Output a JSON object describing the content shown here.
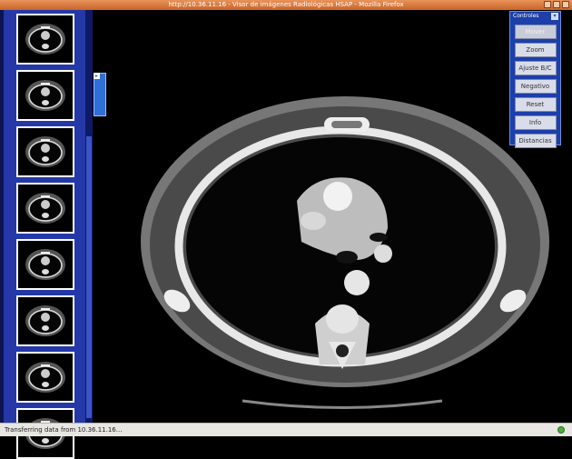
{
  "window": {
    "title": "http://10.36.11.16 - Visor de imágenes Radiológicas HSAP - Mozilla Firefox"
  },
  "thumbnails": {
    "count": 8
  },
  "controls": {
    "header": "Controles",
    "buttons": [
      {
        "label": "Mover",
        "enabled": false
      },
      {
        "label": "Zoom",
        "enabled": true
      },
      {
        "label": "Ajuste B/C",
        "enabled": true
      },
      {
        "label": "Negativo",
        "enabled": true
      },
      {
        "label": "Reset",
        "enabled": true
      },
      {
        "label": "Info",
        "enabled": true
      },
      {
        "label": "Distancias",
        "enabled": true
      }
    ]
  },
  "status": {
    "text": "Transferring data from 10.36.11.16..."
  },
  "colors": {
    "titlebar": "#d5753c",
    "sidebar": "#2438a8",
    "controls_panel": "#1d3faa",
    "viewer_bg": "#000000"
  },
  "icons": {
    "window_buttons": [
      "minimize-icon",
      "maximize-icon",
      "close-icon"
    ],
    "panel_collapse": "collapse-icon",
    "controls_close": "chevron-down-icon",
    "status_secure": "connection-status-icon"
  }
}
